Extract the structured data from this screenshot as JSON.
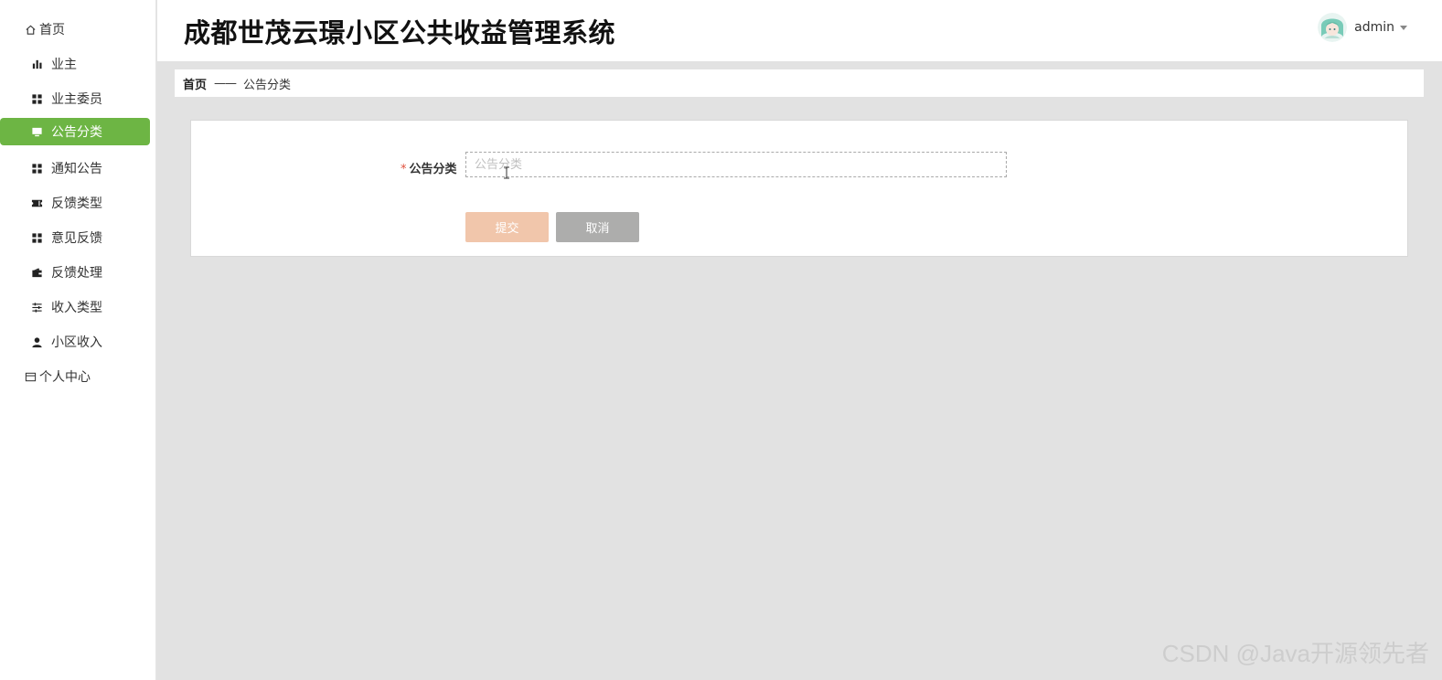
{
  "app": {
    "title": "成都世茂云璟小区公共收益管理系统"
  },
  "user": {
    "name": "admin"
  },
  "sidebar": {
    "items": [
      {
        "label": "首页",
        "icon": "home-icon"
      },
      {
        "label": "业主",
        "icon": "bar-chart-icon"
      },
      {
        "label": "业主委员",
        "icon": "grid-icon"
      },
      {
        "label": "公告分类",
        "icon": "monitor-icon",
        "active": true
      },
      {
        "label": "通知公告",
        "icon": "grid-icon"
      },
      {
        "label": "反馈类型",
        "icon": "ticket-icon"
      },
      {
        "label": "意见反馈",
        "icon": "grid-icon"
      },
      {
        "label": "反馈处理",
        "icon": "wallet-icon"
      },
      {
        "label": "收入类型",
        "icon": "sliders-icon"
      },
      {
        "label": "小区收入",
        "icon": "user-icon"
      },
      {
        "label": "个人中心",
        "icon": "card-icon"
      }
    ]
  },
  "breadcrumb": {
    "home": "首页",
    "separator": "——",
    "current": "公告分类"
  },
  "form": {
    "required_mark": "*",
    "field_label": "公告分类",
    "field_placeholder": "公告分类",
    "field_value": "",
    "submit_label": "提交",
    "cancel_label": "取消"
  },
  "watermark": "CSDN @Java开源领先者",
  "colors": {
    "accent": "#6db544",
    "background": "#e2e2e2",
    "submit_button": "#f1c6ab",
    "cancel_button": "#adadac",
    "required": "#e0503c"
  }
}
